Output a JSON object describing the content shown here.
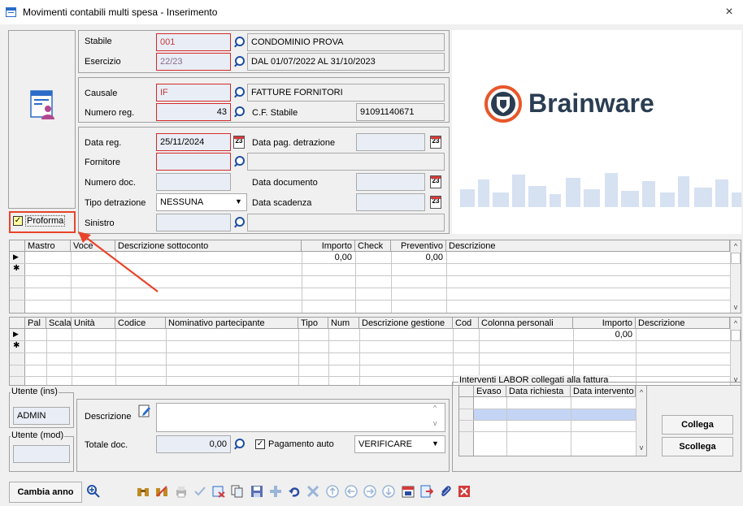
{
  "window": {
    "title": "Movimenti contabili multi spesa - Inserimento",
    "close_glyph": "×"
  },
  "header": {
    "stabile": {
      "label": "Stabile",
      "code": "001",
      "name": "CONDOMINIO PROVA"
    },
    "esercizio": {
      "label": "Esercizio",
      "code": "22/23",
      "description": "DAL 01/07/2022 AL 31/10/2023"
    },
    "causale": {
      "label": "Causale",
      "code": "IF",
      "description": "FATTURE FORNITORI"
    },
    "numero_reg": {
      "label": "Numero reg.",
      "value": "43",
      "cf_label": "C.F. Stabile",
      "cf_value": "91091140671"
    },
    "data_reg": {
      "label": "Data reg.",
      "value": "25/11/2024"
    },
    "data_pag": {
      "label": "Data pag. detrazione",
      "value": ""
    },
    "fornitore": {
      "label": "Fornitore",
      "code": "",
      "name": ""
    },
    "numero_doc": {
      "label": "Numero doc.",
      "value": ""
    },
    "data_documento": {
      "label": "Data documento",
      "value": ""
    },
    "tipo_detrazione": {
      "label": "Tipo detrazione",
      "value": "NESSUNA"
    },
    "data_scadenza": {
      "label": "Data scadenza",
      "value": ""
    },
    "sinistro": {
      "label": "Sinistro",
      "code": "",
      "name": ""
    },
    "proforma": {
      "label": "Proforma",
      "checked": true
    },
    "calendar_glyph": "23"
  },
  "logo": {
    "brand": "Brainware",
    "accent": "#e8562a",
    "dark": "#2a3d52"
  },
  "grid1": {
    "columns": [
      "Mastro",
      "Voce",
      "Descrizione sottoconto",
      "Importo",
      "Check",
      "Preventivo",
      "Descrizione"
    ],
    "row": {
      "importo": "0,00",
      "preventivo": "0,00"
    },
    "row_markers": [
      "▶",
      "✱"
    ]
  },
  "grid2": {
    "columns": [
      "Pal",
      "Scala",
      "Unità",
      "Codice",
      "Nominativo partecipante",
      "Tipo",
      "Num",
      "Descrizione gestione",
      "Cod",
      "Colonna personali",
      "Importo",
      "Descrizione"
    ],
    "row": {
      "importo": "0,00"
    },
    "row_markers": [
      "▶",
      "✱"
    ]
  },
  "footer": {
    "utente_ins": {
      "label": "Utente (ins)",
      "value": "ADMIN"
    },
    "utente_mod": {
      "label": "Utente (mod)",
      "value": ""
    },
    "descrizione": {
      "label": "Descrizione",
      "value": ""
    },
    "totale_doc": {
      "label": "Totale doc.",
      "value": "0,00"
    },
    "pagamento_auto": {
      "label": "Pagamento auto",
      "checked": true,
      "status": "VERIFICARE"
    },
    "interventi": {
      "title": "Interventi LABOR collegati alla fattura",
      "columns": [
        "Evaso",
        "Data richiesta",
        "Data intervento"
      ]
    },
    "collega_label": "Collega",
    "scollega_label": "Scollega"
  },
  "toolbar": {
    "cambia_anno_label": "Cambia anno",
    "icons": [
      "binoculars-icon",
      "binoculars-clear-icon",
      "print-icon",
      "confirm-check-icon",
      "delete-record-icon",
      "copy-icon",
      "save-icon",
      "add-icon",
      "undo-icon",
      "cancel-x-icon",
      "first-record-icon",
      "prev-record-icon",
      "next-record-icon",
      "last-record-icon",
      "calendar-icon",
      "export-icon",
      "attach-icon",
      "close-red-icon"
    ]
  }
}
